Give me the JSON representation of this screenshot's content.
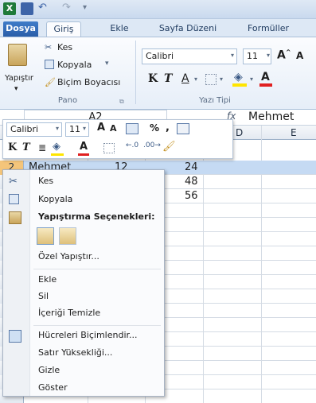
{
  "colors": {
    "accent": "#2a5ea8",
    "selection": "#c5daf3",
    "header_bg": "#dde8f5"
  },
  "tabs": [
    "Dosya",
    "Giriş",
    "Ekle",
    "Sayfa Düzeni",
    "Formüller"
  ],
  "clipboard": {
    "paste": "Yapıştır",
    "cut": "Kes",
    "copy": "Kopyala",
    "format_painter": "Biçim Boyacısı",
    "group": "Pano"
  },
  "font": {
    "name": "Calibri",
    "size": "11",
    "bold": "K",
    "italic": "T",
    "underline": "A",
    "group": "Yazı Tipi"
  },
  "formula": {
    "name_box": "A2",
    "fx": "fx",
    "value": "Mehmet"
  },
  "mini": {
    "font": "Calibri",
    "size": "11",
    "percent": "%",
    "comma": ","
  },
  "columns": [
    "D",
    "E"
  ],
  "rows": [
    {
      "num": "2",
      "a": "Mehmet",
      "b": "12",
      "c": "24"
    },
    {
      "num": "",
      "a": "",
      "b": "",
      "c": "48"
    },
    {
      "num": "",
      "a": "",
      "b": "",
      "c": "56"
    }
  ],
  "menu": {
    "cut": "Kes",
    "copy": "Kopyala",
    "paste_options": "Yapıştırma Seçenekleri:",
    "paste_special": "Özel Yapıştır...",
    "insert": "Ekle",
    "delete": "Sil",
    "clear": "İçeriği Temizle",
    "format_cells": "Hücreleri Biçimlendir...",
    "row_height": "Satır Yüksekliği...",
    "hide": "Gizle",
    "unhide": "Göster"
  }
}
